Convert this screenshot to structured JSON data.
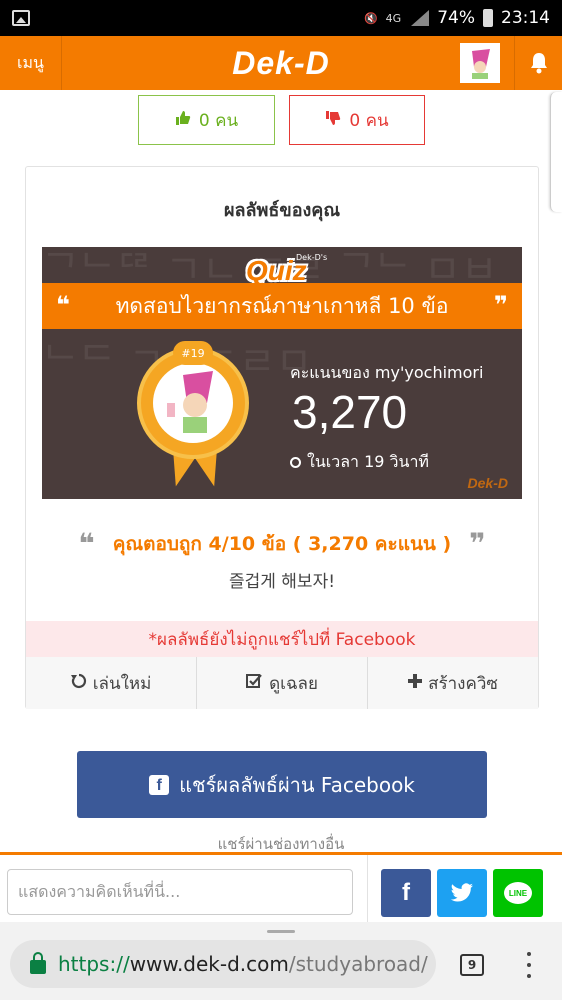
{
  "status_bar": {
    "network": "4G",
    "battery": "74%",
    "time": "23:14"
  },
  "topbar": {
    "menu_label": "เมนู",
    "logo": "Dek-D"
  },
  "votes": {
    "like_count": "0 คน",
    "dislike_count": "0 คน"
  },
  "result_card": {
    "title": "ผลลัพธ์ของคุณ",
    "quiz_badge_small": "Dek-D's",
    "quiz_badge": "Quiz",
    "quiz_title": "ทดสอบไวยากรณ์ภาษาเกาหลี 10 ข้อ",
    "rank": "#19",
    "score_label": "คะแนนของ my'yochimori",
    "score": "3,270",
    "time": "ในเวลา 19 วินาที",
    "watermark": "Dek-D",
    "result_line": "คุณตอบถูก 4/10 ข้อ ( 3,270 คะแนน )",
    "korean_message": "즐겁게 해보자!",
    "share_warning": "*ผลลัพธ์ยังไม่ถูกแชร์ไปที่ Facebook",
    "actions": [
      {
        "label": "เล่นใหม่",
        "icon": "replay-icon"
      },
      {
        "label": "ดูเฉลย",
        "icon": "check-square-icon"
      },
      {
        "label": "สร้างควิซ",
        "icon": "plus-icon"
      }
    ]
  },
  "facebook_share": {
    "label": "แชร์ผลลัพธ์ผ่าน Facebook"
  },
  "other_share": "แชร์ผ่านช่องทางอื่น",
  "comment": {
    "placeholder": "แสดงความคิดเห็นที่นี่..."
  },
  "social": {
    "facebook": "f",
    "line": "LINE"
  },
  "browser": {
    "scheme": "https://",
    "host": "www.dek-d.com",
    "path": "/studyabroad/",
    "tab_count": "9"
  },
  "colors": {
    "brand_orange": "#f47b00",
    "facebook_blue": "#3b5998",
    "twitter_blue": "#1da1f2",
    "line_green": "#00c300",
    "like_green": "#8bc34a",
    "dislike_red": "#e53935"
  }
}
